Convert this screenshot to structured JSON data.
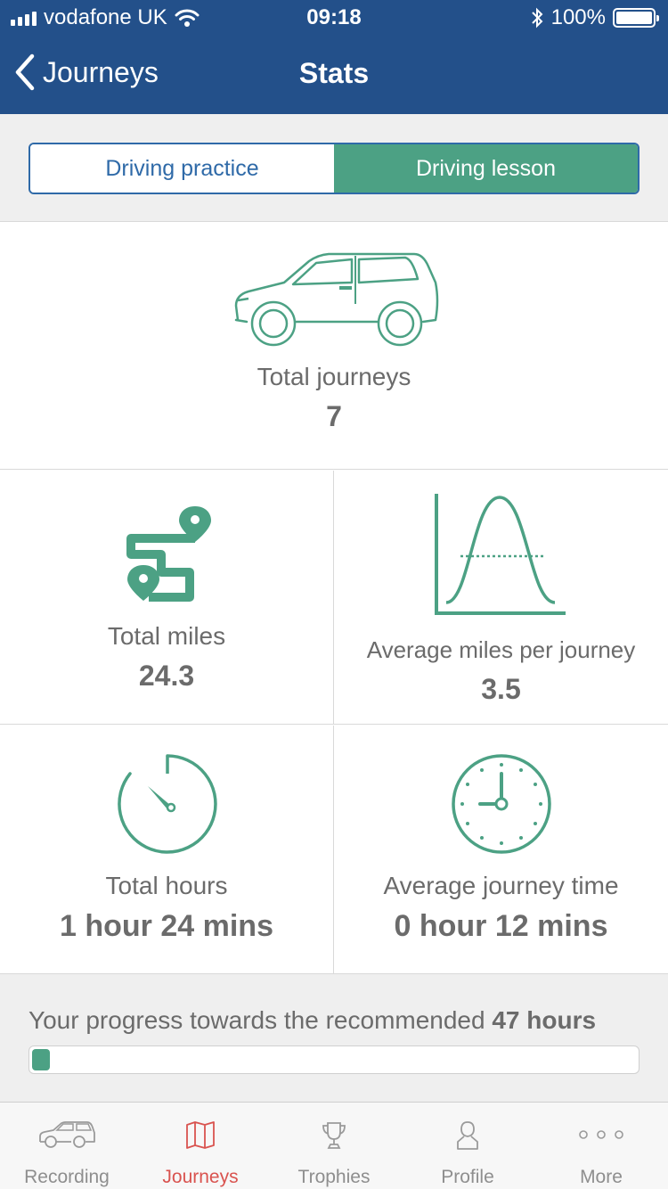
{
  "status_bar": {
    "carrier": "vodafone UK",
    "time": "09:18",
    "battery": "100%",
    "icons": [
      "signal-icon",
      "wifi-icon",
      "bluetooth-icon",
      "battery-icon"
    ]
  },
  "nav": {
    "back_label": "Journeys",
    "title": "Stats"
  },
  "segment": {
    "options": [
      {
        "label": "Driving practice",
        "selected": false
      },
      {
        "label": "Driving lesson",
        "selected": true
      }
    ]
  },
  "stats": {
    "total_journeys": {
      "label": "Total journeys",
      "value": "7",
      "icon": "car-icon"
    },
    "total_miles": {
      "label": "Total miles",
      "value": "24.3",
      "icon": "route-icon"
    },
    "avg_miles": {
      "label": "Average miles per journey",
      "value": "3.5",
      "icon": "bell-curve-icon"
    },
    "total_hours": {
      "label": "Total hours",
      "value": "1 hour 24 mins",
      "icon": "stopwatch-icon"
    },
    "avg_time": {
      "label": "Average journey time",
      "value": "0 hour 12 mins",
      "icon": "clock-icon"
    }
  },
  "progress": {
    "text": "Your progress towards the recommended",
    "target": "47 hours",
    "fraction": 0.03
  },
  "tabs": [
    {
      "label": "Recording",
      "icon": "car-icon",
      "active": false
    },
    {
      "label": "Journeys",
      "icon": "map-icon",
      "active": true
    },
    {
      "label": "Trophies",
      "icon": "trophy-icon",
      "active": false
    },
    {
      "label": "Profile",
      "icon": "person-icon",
      "active": false
    },
    {
      "label": "More",
      "icon": "more-icon",
      "active": false
    }
  ],
  "colors": {
    "header": "#23508a",
    "accent": "#4ca184",
    "segment_border": "#2f6aa8",
    "active_tab": "#d9534f"
  }
}
